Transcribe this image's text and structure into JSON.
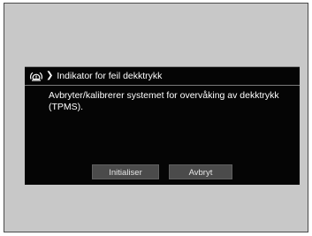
{
  "dialog": {
    "icon": "tpms-warning-icon",
    "title": "Indikator for feil dekktrykk",
    "message": "Avbryter/kalibrerer systemet for overvåking av dekktrykk (TPMS).",
    "buttons": {
      "initialize_label": "Initialiser",
      "cancel_label": "Avbryt"
    }
  },
  "colors": {
    "frame_background": "#c8c8c8",
    "dialog_background": "#050505",
    "button_background": "#4b4b4b",
    "text": "#ffffff"
  }
}
